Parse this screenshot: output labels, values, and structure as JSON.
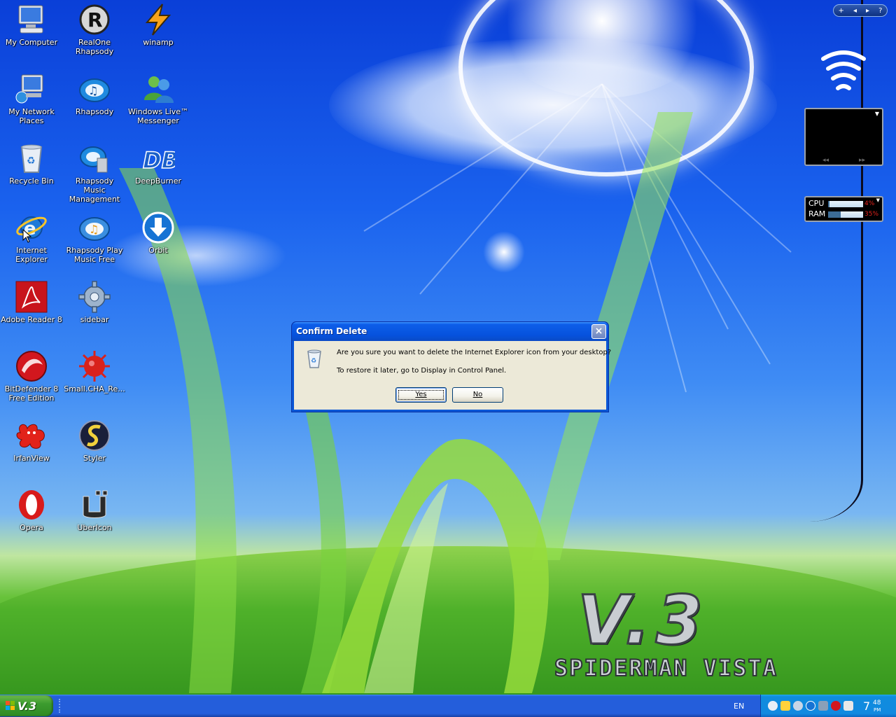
{
  "desktop_icons": [
    {
      "id": "my-computer",
      "label": "My Computer",
      "icon": "computer-icon"
    },
    {
      "id": "realone-rhapsody",
      "label": "RealOne Rhapsody",
      "icon": "realone-icon"
    },
    {
      "id": "winamp",
      "label": "winamp",
      "icon": "winamp-icon"
    },
    {
      "id": "my-network-places",
      "label": "My Network Places",
      "icon": "network-icon"
    },
    {
      "id": "rhapsody",
      "label": "Rhapsody",
      "icon": "rhapsody-icon"
    },
    {
      "id": "windows-live-messenger",
      "label": "Windows Live™ Messenger",
      "icon": "messenger-icon"
    },
    {
      "id": "recycle-bin",
      "label": "Recycle Bin",
      "icon": "recycle-bin-icon"
    },
    {
      "id": "rhapsody-music-management",
      "label": "Rhapsody Music Management",
      "icon": "rhapsody-management-icon"
    },
    {
      "id": "deepburner",
      "label": "DeepBurner",
      "icon": "deepburner-icon"
    },
    {
      "id": "internet-explorer",
      "label": "Internet Explorer",
      "icon": "internet-explorer-icon"
    },
    {
      "id": "rhapsody-play-music-free",
      "label": "Rhapsody Play Music Free",
      "icon": "rhapsody-play-icon"
    },
    {
      "id": "orbit",
      "label": "Orbit",
      "icon": "orbit-download-icon"
    },
    {
      "id": "adobe-reader-8",
      "label": "Adobe Reader 8",
      "icon": "adobe-reader-icon"
    },
    {
      "id": "sidebar",
      "label": "sidebar",
      "icon": "gear-icon"
    },
    {
      "id": "bitdefender-8",
      "label": "BitDefender 8 Free Edition",
      "icon": "bitdefender-icon"
    },
    {
      "id": "small-cha-re",
      "label": "Small.CHA_Re...",
      "icon": "virus-icon"
    },
    {
      "id": "irfanview",
      "label": "IrfanView",
      "icon": "irfanview-icon"
    },
    {
      "id": "styler",
      "label": "Styler",
      "icon": "styler-icon"
    },
    {
      "id": "opera",
      "label": "Opera",
      "icon": "opera-icon"
    },
    {
      "id": "ubericon",
      "label": "UberIcon",
      "icon": "ubericon-icon"
    }
  ],
  "dialog": {
    "title": "Confirm Delete",
    "message": "Are you sure you want to delete the Internet Explorer icon from your desktop?",
    "hint": "To restore it later, go to Display in Control Panel.",
    "yes_label": "Yes",
    "no_label": "No",
    "close_glyph": "×",
    "icon": "recycle-bin-icon"
  },
  "wallpaper": {
    "logo": "V.3",
    "subtitle": "SPIDERMAN VISTA"
  },
  "gadgets": {
    "sidebar_nav": [
      "+",
      "◂",
      "▸",
      "?"
    ],
    "system_monitor": {
      "cpu_label": "CPU",
      "cpu_value": "4%",
      "cpu_level": 0.04,
      "ram_label": "RAM",
      "ram_value": "35%",
      "ram_level": 0.35
    },
    "media_nav": [
      "◂◂",
      "▸▸"
    ]
  },
  "taskbar": {
    "start_label": "V.3",
    "language": "EN",
    "clock_hour": "7",
    "clock_minute": "48",
    "clock_ampm": "PM"
  },
  "colors": {
    "titlebar": "#0652dd",
    "dialog_face": "#ece9d8",
    "taskbar": "#245edb",
    "tray": "#118ae0",
    "start_button": "#3c9c2f"
  }
}
